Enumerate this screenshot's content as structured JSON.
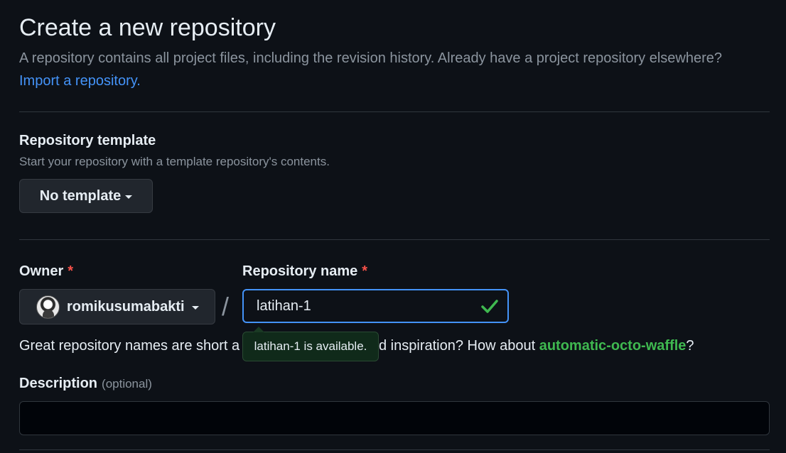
{
  "header": {
    "title": "Create a new repository",
    "subtitle": "A repository contains all project files, including the revision history. Already have a project repository elsewhere?",
    "import_link": "Import a repository."
  },
  "template": {
    "label": "Repository template",
    "helper": "Start your repository with a template repository's contents.",
    "button_label": "No template"
  },
  "owner": {
    "label": "Owner",
    "required_mark": "*",
    "username": "romikusumabakti"
  },
  "separator": "/",
  "repository_name": {
    "label": "Repository name",
    "required_mark": "*",
    "value": "latihan-1",
    "availability_tooltip": "latihan-1 is available."
  },
  "name_hint": {
    "text_before": "Great repository names are short a",
    "text_after": "d inspiration? How about ",
    "suggestion": "automatic-octo-waffle",
    "end": "?"
  },
  "description": {
    "label": "Description",
    "optional": "(optional)",
    "value": ""
  },
  "colors": {
    "background": "#0d1117",
    "link": "#4493f8",
    "success": "#3fb950",
    "required": "#f85149"
  }
}
